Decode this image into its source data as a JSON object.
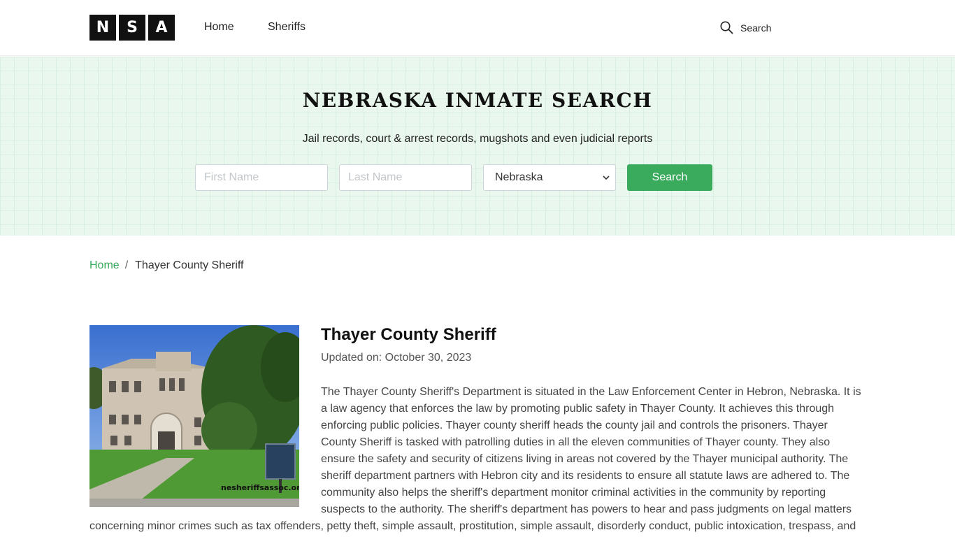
{
  "header": {
    "logo_letters": [
      "N",
      "S",
      "A"
    ],
    "nav": {
      "home": "Home",
      "sheriffs": "Sheriffs"
    },
    "search_label": "Search"
  },
  "hero": {
    "title": "NEBRASKA INMATE SEARCH",
    "subtitle": "Jail records, court & arrest records, mugshots and even judicial reports",
    "first_name_placeholder": "First Name",
    "last_name_placeholder": "Last Name",
    "state_selected": "Nebraska",
    "search_button": "Search"
  },
  "breadcrumb": {
    "home": "Home",
    "separator": "/",
    "current": "Thayer County Sheriff"
  },
  "article": {
    "title": "Thayer County Sheriff",
    "updated_label": "Updated on:",
    "updated_date": "October 30, 2023",
    "photo_watermark": "nesheriffsassoc.org",
    "body": "The Thayer County Sheriff's Department is situated in the Law Enforcement Center in Hebron, Nebraska. It is a law agency that enforces the law by promoting public safety in Thayer County. It achieves this through enforcing public policies. Thayer county sheriff heads the county jail and controls the prisoners.   Thayer County Sheriff is tasked with patrolling duties in all the eleven communities of Thayer county. They also ensure the safety and security of citizens living in areas not covered by the Thayer municipal authority.  The sheriff department partners with Hebron city and its residents to ensure all statute laws are adhered to. The community also helps the sheriff's department monitor criminal activities in the community by reporting suspects to the authority.   The sheriff's department has powers to hear and pass judgments on legal matters concerning minor crimes such as tax offenders, petty theft, simple assault, prostitution, simple assault, disorderly conduct, public intoxication, trespass, and"
  },
  "colors": {
    "accent": "#3aaa5c",
    "hero_bg": "#eaf7ee",
    "logo_bg": "#111111"
  },
  "icons": {
    "search": "search-icon",
    "select_arrow": "chevron-down-icon"
  }
}
